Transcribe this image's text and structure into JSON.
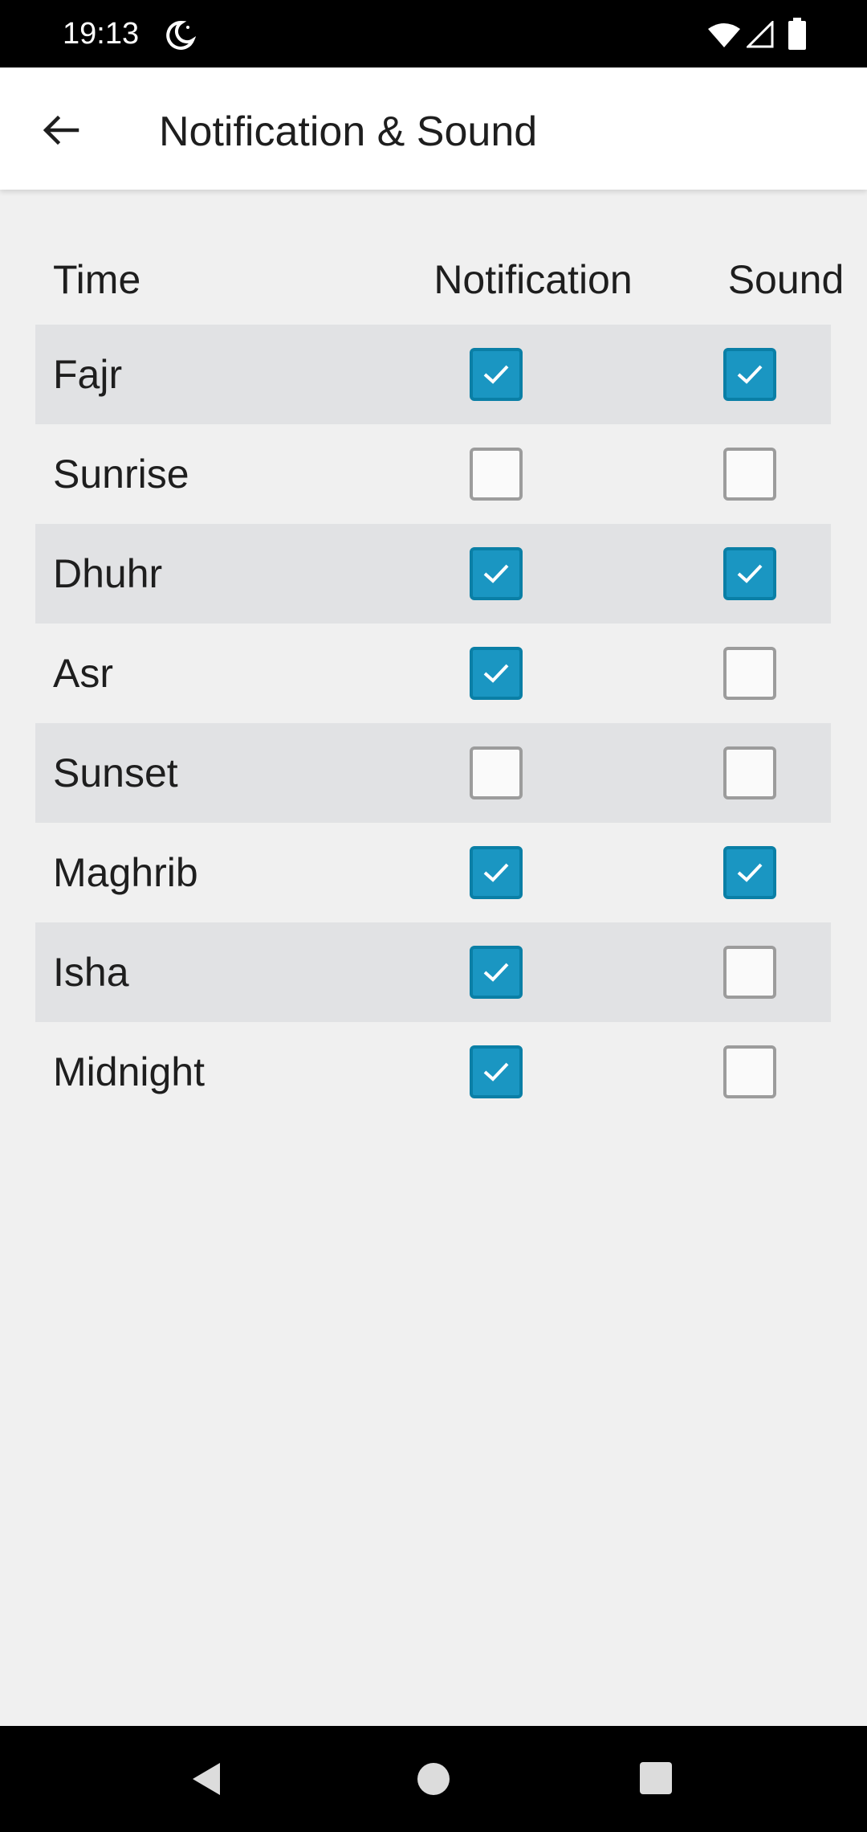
{
  "status_bar": {
    "time": "19:13",
    "icons": [
      "moon-icon",
      "wifi-icon",
      "signal-icon",
      "battery-icon"
    ]
  },
  "app_bar": {
    "back_icon": "arrow-left-icon",
    "title": "Notification & Sound"
  },
  "table": {
    "headers": {
      "time": "Time",
      "notification": "Notification",
      "sound": "Sound"
    },
    "rows": [
      {
        "name": "Fajr",
        "notification": true,
        "sound": true
      },
      {
        "name": "Sunrise",
        "notification": false,
        "sound": false
      },
      {
        "name": "Dhuhr",
        "notification": true,
        "sound": true
      },
      {
        "name": "Asr",
        "notification": true,
        "sound": false
      },
      {
        "name": "Sunset",
        "notification": false,
        "sound": false
      },
      {
        "name": "Maghrib",
        "notification": true,
        "sound": true
      },
      {
        "name": "Isha",
        "notification": true,
        "sound": false
      },
      {
        "name": "Midnight",
        "notification": true,
        "sound": false
      }
    ]
  },
  "colors": {
    "accent": "#1a96c2",
    "row_shade": "#e1e2e4",
    "background": "#f0f0f0"
  },
  "nav_bar": {
    "icons": [
      "back-triangle-icon",
      "home-circle-icon",
      "recents-square-icon"
    ]
  }
}
